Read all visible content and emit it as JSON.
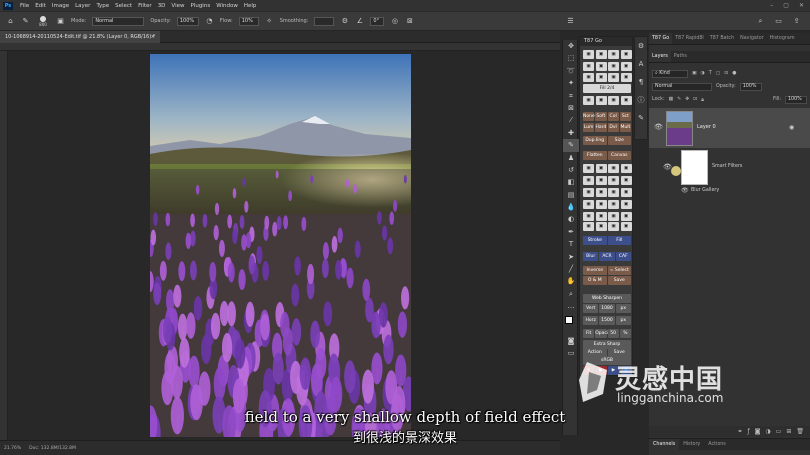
{
  "app": {
    "logo": "Ps",
    "menu": [
      "File",
      "Edit",
      "Image",
      "Layer",
      "Type",
      "Select",
      "Filter",
      "3D",
      "View",
      "Plugins",
      "Window",
      "Help"
    ],
    "window_controls": [
      "–",
      "▢",
      "✕"
    ]
  },
  "options": {
    "brush_size": "800",
    "mode_label": "Mode:",
    "mode_value": "Normal",
    "opacity_label": "Opacity:",
    "opacity_value": "100%",
    "flow_label": "Flow:",
    "flow_value": "10%",
    "smoothing_label": "Smoothing:",
    "angle_value": "0°"
  },
  "document": {
    "tab_title": "10-1068914-20110524-Edit.tif @ 21.8% (Layer 0, RGB/16) *",
    "close": "×",
    "zoom": "21.76%",
    "doc_info": "Doc: 132.8M/132.8M"
  },
  "t87_panel": {
    "title": "T87 Go",
    "rows": [
      [
        "Fill 2/4"
      ],
      [
        "None",
        "Soft",
        "Col",
        "Sct"
      ],
      [
        "Lum",
        "Hard",
        "Dvl",
        "Mult"
      ],
      [
        "Dup.ling",
        "Size"
      ],
      [
        "Flatten",
        "Canvas"
      ],
      [
        "Stroke",
        "Fill"
      ],
      [
        "Blur",
        "ACR",
        "CAF"
      ],
      [
        "Inverse",
        "= Select"
      ],
      [
        "O & M",
        "Save"
      ],
      [
        "Web Sharpen"
      ],
      [
        "Vert",
        "1080",
        "px"
      ],
      [
        "Horz",
        "1500",
        "px"
      ],
      [
        "Fit",
        "Opacity",
        "50",
        "%"
      ],
      [
        "Extra Sharp"
      ],
      [
        "Action",
        "Save"
      ],
      [
        "sRGB"
      ]
    ]
  },
  "panels": {
    "top_tabs": [
      "T87 Go",
      "T87 Rapid8l",
      "T87 Batch",
      "Navigator",
      "Histogram"
    ],
    "layer_tabs": [
      "Layers",
      "Paths"
    ],
    "kind_label": "Kind",
    "blend_mode": "Normal",
    "opacity_label": "Opacity:",
    "opacity_value": "100%",
    "lock_label": "Lock:",
    "fill_label": "Fill:",
    "fill_value": "100%",
    "layers": [
      {
        "name": "Layer 0"
      },
      {
        "name": "Smart Filters"
      },
      {
        "name": "Blur Gallery"
      }
    ],
    "bottom_tabs": [
      "Channels",
      "History",
      "Actions"
    ]
  },
  "subtitle": {
    "en": "field to a very shallow depth of field effect",
    "zh": "到很浅的景深效果"
  },
  "watermark": {
    "title": "灵感中国",
    "url": "lingganchina.com"
  }
}
